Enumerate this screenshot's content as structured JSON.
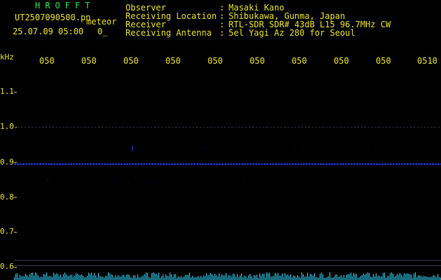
{
  "header": {
    "station": "HROFFT",
    "filename": "UT2507090500.pn",
    "detector_label": "meteor",
    "datetime": "25.07.09 05:00",
    "counter": "0_",
    "observer_label": "Observer",
    "observer": "Masaki Kano",
    "location_label": "Receiving Location",
    "location": "Shibukawa, Gunma, Japan",
    "receiver_label": "Receiver",
    "receiver": "RTL-SDR SDR# 43dB L15 96.7MHz CW",
    "antenna_label": "Receiving Antenna",
    "antenna": "5el Yagi Az 280 for Seoul",
    "separator": ":"
  },
  "chart_data": {
    "type": "heatmap",
    "y_unit": "kHz",
    "y_ticks": [
      "1.1",
      "1.0",
      "0.9",
      "0.8",
      "0.7",
      "0.6"
    ],
    "y_tick_values": [
      1.1,
      1.0,
      0.9,
      0.8,
      0.7,
      0.6
    ],
    "x_ticks": [
      "050",
      "050",
      "050",
      "050",
      "050",
      "050",
      "050",
      "050",
      "050",
      "0510"
    ],
    "ylim": [
      0.58,
      1.2
    ],
    "carrier_khz": 0.895,
    "reference_lines_khz": [
      1.0,
      0.62,
      0.605
    ],
    "colors": {
      "background": "#000000",
      "text": "#e8e020",
      "station": "#22e04a",
      "signal": "#2a3aff",
      "noise": "#30d8ff",
      "ref_line": "#3a3a5a"
    }
  }
}
